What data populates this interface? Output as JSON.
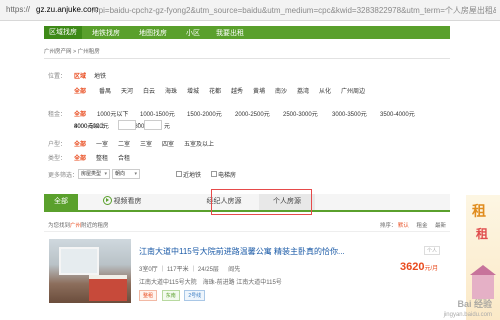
{
  "address": {
    "scheme": "https://",
    "domain": "gz.zu.anjuke.com",
    "path": "/?pi=baidu-cpchz-gz-fyong2&utm_source=baidu&utm_medium=cpc&kwid=3283822978&utm_term=个人房屋出租&u"
  },
  "nav": [
    "区域找房",
    "地铁找房",
    "地图找房",
    "小区",
    "我要出租"
  ],
  "breadcrumb": "广州房产网 > 广州租房",
  "filters": {
    "location": {
      "label": "位置：",
      "modes": [
        "区域",
        "地铁"
      ],
      "options": [
        "全部",
        "番禺",
        "天河",
        "白云",
        "海珠",
        "增城",
        "花都",
        "越秀",
        "黄埔",
        "南沙",
        "荔湾",
        "从化",
        "广州周边"
      ]
    },
    "rent": {
      "label": "租金：",
      "options": [
        "全部",
        "1000元以下",
        "1000-1500元",
        "1500-2000元",
        "2000-2500元",
        "2500-3000元",
        "3000-3500元",
        "3500-4000元",
        "4000-5000元",
        "5000-8000元",
        "8000元以上"
      ],
      "dash": "-",
      "unit": "元"
    },
    "layout": {
      "label": "户型：",
      "options": [
        "全部",
        "一室",
        "二室",
        "三室",
        "四室",
        "五室及以上"
      ]
    },
    "type": {
      "label": "类型：",
      "options": [
        "全部",
        "整租",
        "合租"
      ]
    },
    "more": {
      "label": "更多筛选：",
      "selects": [
        "房屋类型",
        "朝向"
      ],
      "checks": [
        "近地铁",
        "电梯房"
      ]
    }
  },
  "tabs": {
    "all": "全部",
    "video": "视频看房",
    "agent": "经纪人房源",
    "personal": "个人房源"
  },
  "subhead": {
    "near_prefix": "为您找到",
    "near_city": "广州",
    "near_suffix": "附近的租房",
    "sort_label": "排序：",
    "sort_default": "默认",
    "sort_rent": "租金",
    "sort_latest": "最新"
  },
  "listing": {
    "title": "江南大道中115号大院前进路温馨公寓 精装主卧真的恰你...",
    "rent_tag": "个人",
    "meta": "3室0厅 ｜ 117平米 ｜ 24/25层 　 阎先",
    "address": "江南大道中115号大院　海珠-前进路 江南大道中115号",
    "tags": [
      "整租",
      "东南",
      "2号线"
    ],
    "price": "3620",
    "price_unit": "元/月"
  },
  "ad": {
    "line1": "租",
    "line2": "租"
  },
  "watermark": {
    "line1": "Bai 经验",
    "line2": "jingyan.baidu.com"
  }
}
